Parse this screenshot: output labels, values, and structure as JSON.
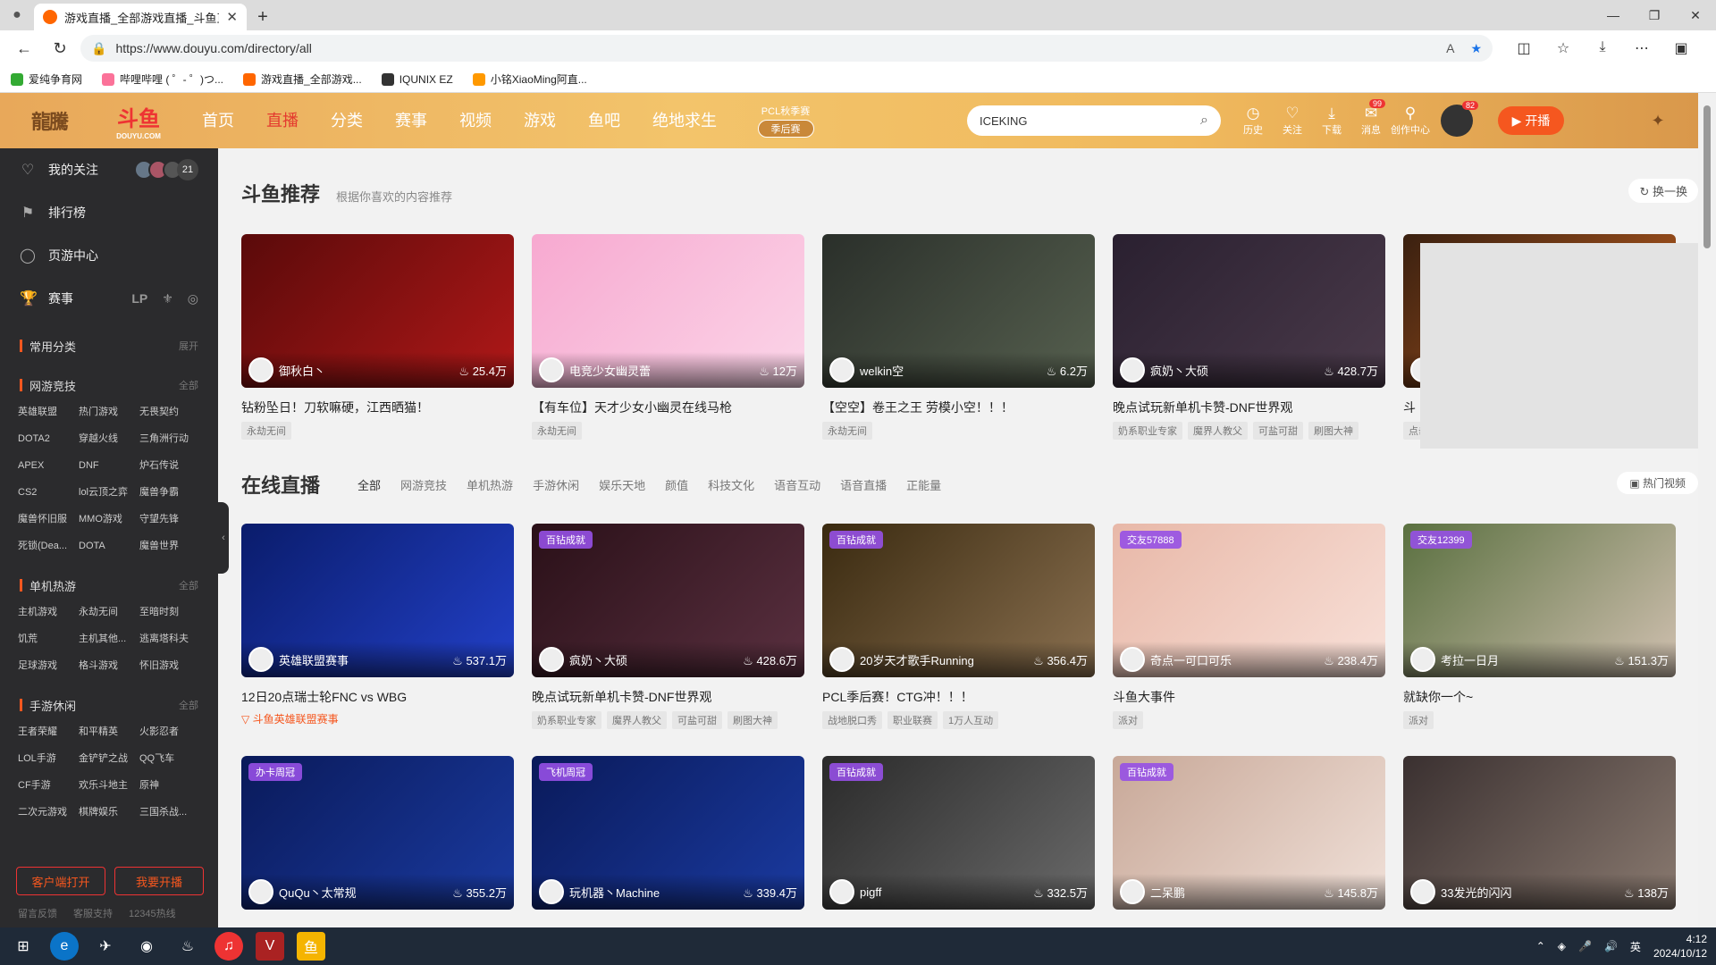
{
  "browser": {
    "tab_title": "游戏直播_全部游戏直播_斗鱼直播",
    "url": "https://www.douyu.com/directory/all",
    "bookmarks": [
      "爱纯争育网",
      "哔哩哔哩 ( ゜- ゜)つ...",
      "游戏直播_全部游戏...",
      "IQUNIX EZ",
      "小铭XiaoMing阿直..."
    ]
  },
  "header": {
    "logo_text": "斗鱼",
    "logo_sub": "DOUYU.COM",
    "nav": [
      "首页",
      "直播",
      "分类",
      "赛事",
      "视频",
      "游戏",
      "鱼吧",
      "绝地求生"
    ],
    "pcl_title": "PCL秋季赛",
    "pcl_sub": "季后赛",
    "search_value": "ICEKING",
    "tools": [
      "历史",
      "关注",
      "下载",
      "消息",
      "创作中心"
    ],
    "msg_badge": "99",
    "avatar_badge": "82",
    "live_button": "开播"
  },
  "sidebar": {
    "items": [
      "我的关注",
      "排行榜",
      "页游中心",
      "赛事"
    ],
    "follow_count": "21",
    "common": "常用分类",
    "common_more": "展开",
    "sections": [
      {
        "title": "网游竞技",
        "more": "全部",
        "items": [
          "英雄联盟",
          "热门游戏",
          "无畏契约",
          "DOTA2",
          "穿越火线",
          "三角洲行动",
          "APEX",
          "DNF",
          "炉石传说",
          "CS2",
          "lol云顶之弈",
          "魔兽争霸",
          "魔兽怀旧服",
          "MMO游戏",
          "守望先锋",
          "死锁(Dea...",
          "DOTA",
          "魔兽世界"
        ]
      },
      {
        "title": "单机热游",
        "more": "全部",
        "items": [
          "主机游戏",
          "永劫无间",
          "至暗时刻",
          "饥荒",
          "主机其他...",
          "逃离塔科夫",
          "足球游戏",
          "格斗游戏",
          "怀旧游戏"
        ]
      },
      {
        "title": "手游休闲",
        "more": "全部",
        "items": [
          "王者荣耀",
          "和平精英",
          "火影忍者",
          "LOL手游",
          "金铲铲之战",
          "QQ飞车",
          "CF手游",
          "欢乐斗地主",
          "原神",
          "二次元游戏",
          "棋牌娱乐",
          "三国杀战..."
        ]
      }
    ],
    "btn_client": "客户端打开",
    "btn_live": "我要开播",
    "footer": [
      "留言反馈",
      "客服支持",
      "12345热线"
    ]
  },
  "rec": {
    "title": "斗鱼推荐",
    "subtitle": "根据你喜欢的内容推荐",
    "refresh": "换一换",
    "cards": [
      {
        "name": "御秋白丶",
        "hot": "25.4万",
        "title": "钻粉坠日！刀软嘛硬，江西晒猫！",
        "tags": [
          "永劫无间"
        ]
      },
      {
        "name": "电竞少女幽灵蕾",
        "hot": "12万",
        "title": "【有车位】天才少女小幽灵在线马枪",
        "tags": [
          "永劫无间"
        ]
      },
      {
        "name": "welkin空",
        "hot": "6.2万",
        "title": "【空空】卷王之王 劳模小空！！！",
        "tags": [
          "永劫无间"
        ]
      },
      {
        "name": "疯奶丶大硕",
        "hot": "428.7万",
        "title": "晚点试玩新单机卡赞-DNF世界观",
        "tags": [
          "奶系职业专家",
          "魔界人教父",
          "可盐可甜",
          "刷图大神"
        ]
      },
      {
        "name": "",
        "hot": "",
        "title": "斗",
        "tags": [
          "点击"
        ]
      }
    ]
  },
  "live": {
    "title": "在线直播",
    "tabs": [
      "全部",
      "网游竞技",
      "单机热游",
      "手游休闲",
      "娱乐天地",
      "颜值",
      "科技文化",
      "语音互动",
      "语音直播",
      "正能量"
    ],
    "hot_video": "热门视频",
    "row1": [
      {
        "badge": "",
        "name": "英雄联盟赛事",
        "hot": "537.1万",
        "title": "12日20点瑞士轮FNC vs WBG",
        "source": "斗鱼英雄联盟赛事",
        "tags": []
      },
      {
        "badge": "百钻成就",
        "name": "疯奶丶大硕",
        "hot": "428.6万",
        "title": "晚点试玩新单机卡赞-DNF世界观",
        "tags": [
          "奶系职业专家",
          "魔界人教父",
          "可盐可甜",
          "刷图大神"
        ]
      },
      {
        "badge": "百钻成就",
        "name": "20岁天才歌手Running",
        "hot": "356.4万",
        "title": "PCL季后赛！CTG冲！！！",
        "tags": [
          "战地脱口秀",
          "职业联赛",
          "1万人互动"
        ]
      },
      {
        "badge": "交友57888",
        "name": "奇点一可口可乐",
        "hot": "238.4万",
        "title": "斗鱼大事件",
        "tags": [
          "派对"
        ]
      },
      {
        "badge": "交友12399",
        "name": "考拉一日月",
        "hot": "151.3万",
        "title": "就缺你一个~",
        "tags": [
          "派对"
        ]
      }
    ],
    "row2": [
      {
        "badge": "办卡周冠",
        "name": "QuQu丶太常规",
        "hot": "355.2万"
      },
      {
        "badge": "飞机周冠",
        "name": "玩机器丶Machine",
        "hot": "339.4万"
      },
      {
        "badge": "百钻成就",
        "name": "pigff",
        "hot": "332.5万"
      },
      {
        "badge": "百钻成就",
        "name": "二呆鹏",
        "hot": "145.8万"
      },
      {
        "badge": "",
        "name": "33发光的闪闪",
        "hot": "138万"
      }
    ]
  },
  "taskbar": {
    "time": "4:12",
    "date": "2024/10/12",
    "ime": "英"
  }
}
